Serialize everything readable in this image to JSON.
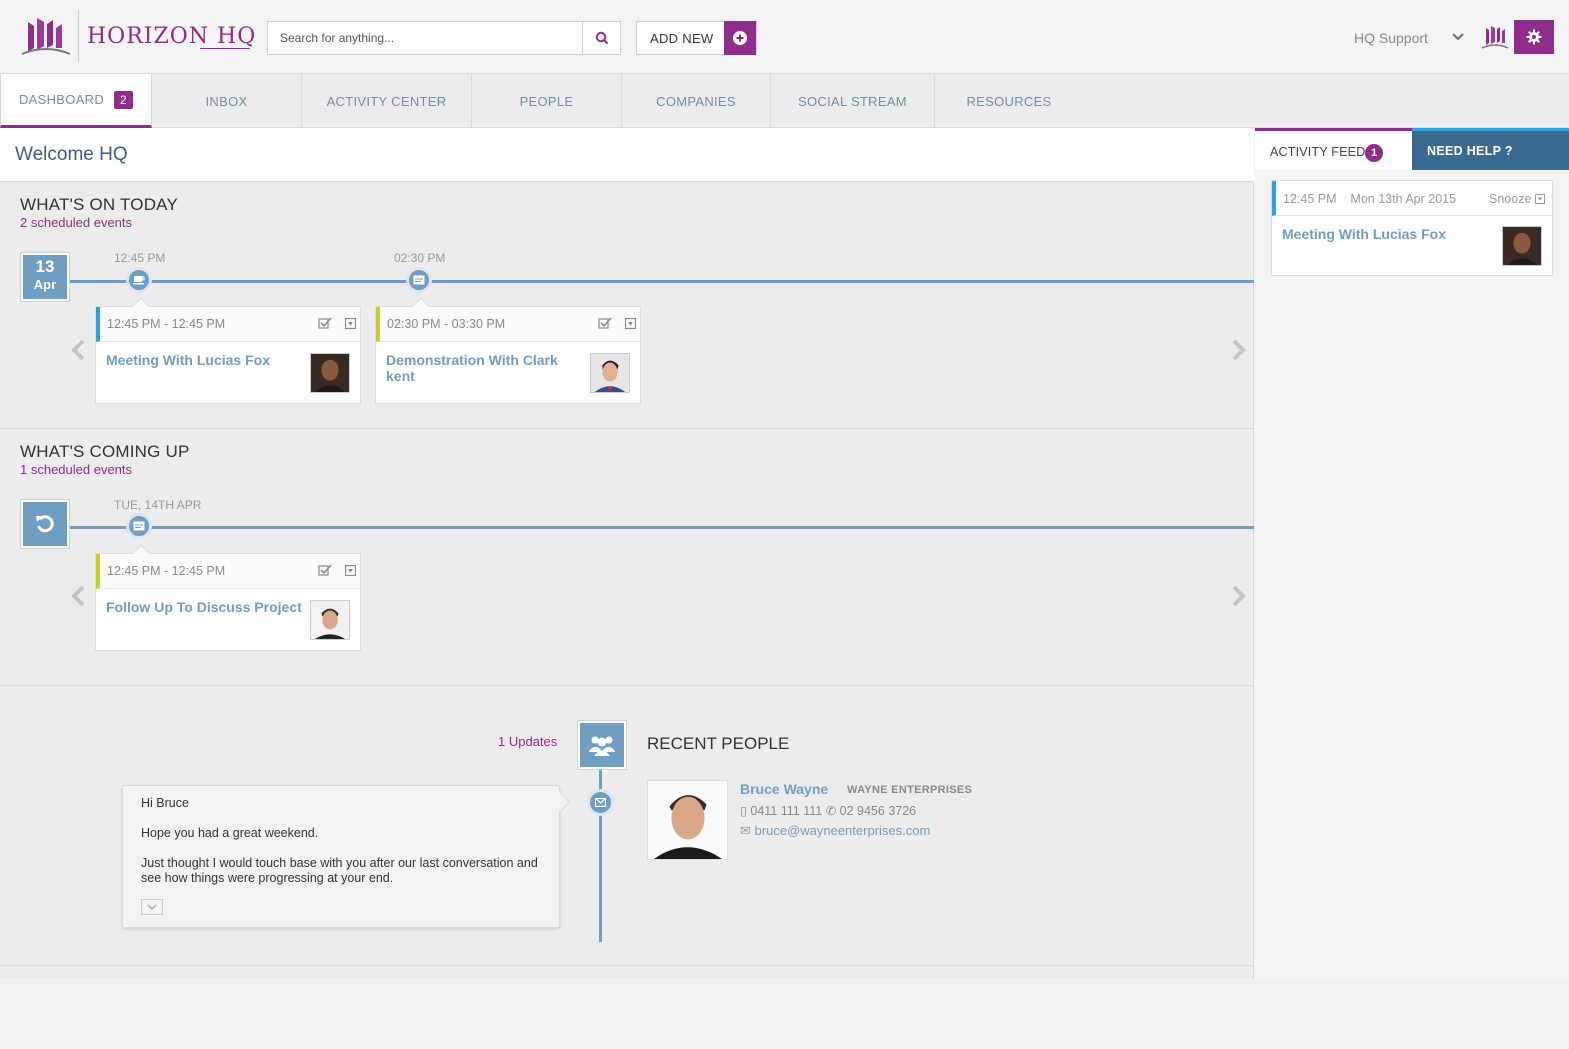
{
  "header": {
    "brand": "HORIZON HQ",
    "search_placeholder": "Search for anything...",
    "add_new_label": "ADD NEW",
    "user_menu": "HQ Support"
  },
  "tabs": [
    {
      "label": "DASHBOARD",
      "badge": "2",
      "active": true
    },
    {
      "label": "INBOX"
    },
    {
      "label": "ACTIVITY CENTER"
    },
    {
      "label": "PEOPLE"
    },
    {
      "label": "COMPANIES"
    },
    {
      "label": "SOCIAL STREAM"
    },
    {
      "label": "RESOURCES"
    }
  ],
  "welcome": "Welcome HQ",
  "today": {
    "title": "WHAT'S ON TODAY",
    "subtitle": "2 scheduled events",
    "date_day": "13",
    "date_month": "Apr",
    "events": [
      {
        "marker_time": "12:45 PM",
        "time": "12:45 PM - 12:45 PM",
        "title": "Meeting With Lucias Fox",
        "accent": "#2aa3e0"
      },
      {
        "marker_time": "02:30 PM",
        "time": "02:30 PM - 03:30 PM",
        "title": "Demonstration With Clark kent",
        "accent": "#c6cf1e"
      }
    ]
  },
  "upcoming": {
    "title": "WHAT'S COMING UP",
    "subtitle": "1 scheduled events",
    "events": [
      {
        "marker_time": "TUE, 14TH APR",
        "time": "12:45 PM - 12:45 PM",
        "title": "Follow Up To Discuss Project",
        "accent": "#c6cf1e"
      }
    ]
  },
  "recent_people": {
    "title": "RECENT PEOPLE",
    "updates": "1 Updates",
    "message": {
      "greeting": "Hi Bruce",
      "line1": "Hope you had a great weekend.",
      "line2": "Just thought I would touch base with you after our last conversation and see how things were progressing at your end."
    },
    "person": {
      "name": "Bruce Wayne",
      "company": "WAYNE ENTERPRISES",
      "mobile": "0411 111 111",
      "phone": "02 9456 3726",
      "email": "bruce@wayneenterprises.com"
    }
  },
  "activity_feed": {
    "tab_label": "ACTIVITY FEED",
    "badge": "1",
    "help_label": "NEED HELP ?",
    "item": {
      "time": "12:45 PM",
      "date": "Mon 13th Apr 2015",
      "snooze": "Snooze",
      "title": "Meeting With Lucias Fox"
    }
  },
  "colors": {
    "brand_purple": "#8e2d8a",
    "timeline_blue": "#6f9ec2",
    "accent_blue": "#2aa3e0",
    "accent_yellow": "#c6cf1e"
  }
}
